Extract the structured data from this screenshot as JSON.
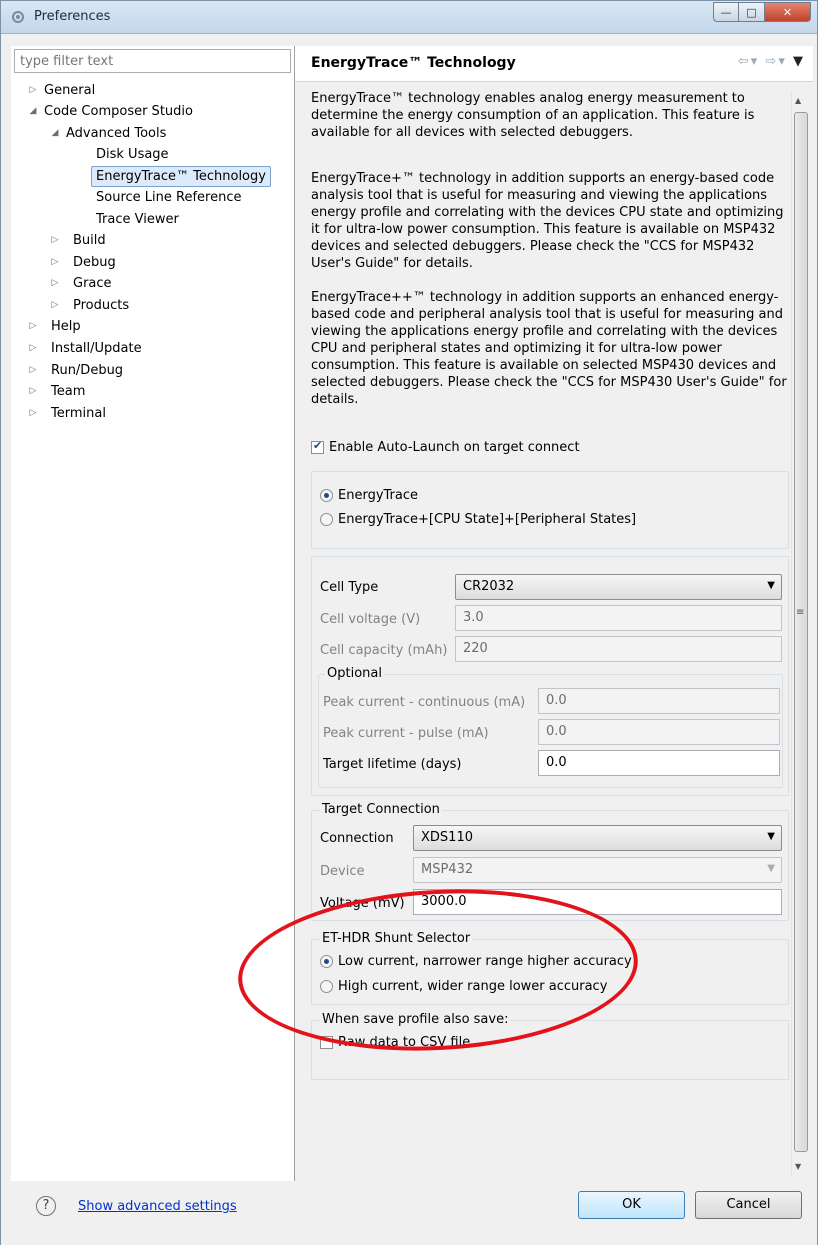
{
  "window": {
    "title": "Preferences"
  },
  "sidebar": {
    "filter_placeholder": "type filter text",
    "items": [
      {
        "label": "General",
        "expanded": false
      },
      {
        "label": "Code Composer Studio",
        "expanded": true
      },
      {
        "label": "Advanced Tools",
        "expanded": true
      },
      {
        "label": "Disk Usage"
      },
      {
        "label": "EnergyTrace™ Technology",
        "selected": true
      },
      {
        "label": "Source Line Reference"
      },
      {
        "label": "Trace Viewer"
      },
      {
        "label": "Build",
        "expanded": false
      },
      {
        "label": "Debug",
        "expanded": false
      },
      {
        "label": "Grace",
        "expanded": false
      },
      {
        "label": "Products",
        "expanded": false
      },
      {
        "label": "Help",
        "expanded": false
      },
      {
        "label": "Install/Update",
        "expanded": false
      },
      {
        "label": "Run/Debug",
        "expanded": false
      },
      {
        "label": "Team",
        "expanded": false
      },
      {
        "label": "Terminal",
        "expanded": false
      }
    ]
  },
  "page": {
    "title": "EnergyTrace™ Technology",
    "para1": "EnergyTrace™ technology enables analog energy measurement to determine the energy consumption of an application. This feature is available for all devices with selected debuggers.",
    "para2": "EnergyTrace+™ technology in addition supports an energy-based code analysis tool that is useful for measuring and viewing the applications energy profile and correlating with the devices CPU state and optimizing it for ultra-low power consumption. This feature is available on MSP432 devices and selected debuggers. Please check the \"CCS for MSP432 User's Guide\" for details.",
    "para3": "EnergyTrace++™ technology in addition supports an enhanced energy-based code and peripheral analysis tool that is useful for measuring and viewing the applications energy profile and correlating with the devices CPU and peripheral states and optimizing it for ultra-low power consumption. This feature is available on selected MSP430 devices and selected debuggers. Please check the \"CCS for MSP430 User's Guide\" for details.",
    "auto_launch_label": "Enable Auto-Launch on target connect",
    "auto_launch_checked": true,
    "mode_options": [
      {
        "label": "EnergyTrace",
        "checked": true
      },
      {
        "label": "EnergyTrace+[CPU State]+[Peripheral States]",
        "checked": false
      }
    ],
    "cell": {
      "type_label": "Cell Type",
      "type_value": "CR2032",
      "voltage_label": "Cell voltage (V)",
      "voltage_value": "3.0",
      "capacity_label": "Cell capacity (mAh)",
      "capacity_value": "220",
      "optional_label": "Optional",
      "peak_cont_label": "Peak current - continuous (mA)",
      "peak_cont_value": "0.0",
      "peak_pulse_label": "Peak current - pulse (mA)",
      "peak_pulse_value": "0.0",
      "lifetime_label": "Target lifetime (days)",
      "lifetime_value": "0.0"
    },
    "target": {
      "group_label": "Target Connection",
      "connection_label": "Connection",
      "connection_value": "XDS110",
      "device_label": "Device",
      "device_value": "MSP432",
      "voltage_label": "Voltage (mV)",
      "voltage_value": "3000.0"
    },
    "shunt": {
      "group_label": "ET-HDR Shunt Selector",
      "options": [
        {
          "label": "Low current, narrower range higher accuracy",
          "checked": true
        },
        {
          "label": "High current, wider range lower accuracy",
          "checked": false
        }
      ]
    },
    "save": {
      "group_label": "When save profile also save:",
      "raw_label": "Raw data to CSV file",
      "raw_checked": false
    }
  },
  "footer": {
    "help_glyph": "?",
    "advanced_link": "Show advanced settings",
    "ok_label": "OK",
    "cancel_label": "Cancel"
  },
  "colors": {
    "annotation_red": "#e3131b",
    "link_blue": "#0033cc",
    "selection_bg": "#dcebfc"
  }
}
